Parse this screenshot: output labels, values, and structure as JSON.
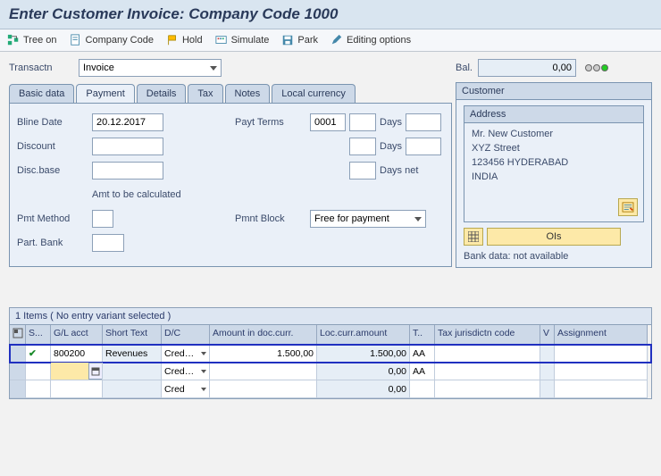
{
  "title": "Enter Customer Invoice: Company Code 1000",
  "toolbar": {
    "tree_on": "Tree on",
    "company_code": "Company Code",
    "hold": "Hold",
    "simulate": "Simulate",
    "park": "Park",
    "editing_options": "Editing options"
  },
  "transactn_label": "Transactn",
  "transactn_value": "Invoice",
  "balance": {
    "label": "Bal.",
    "value": "0,00"
  },
  "tabs": {
    "basic_data": "Basic data",
    "payment": "Payment",
    "details": "Details",
    "tax": "Tax",
    "notes": "Notes",
    "local_currency": "Local currency"
  },
  "payment": {
    "bline_date_label": "Bline Date",
    "bline_date_value": "20.12.2017",
    "discount_label": "Discount",
    "disc_base_label": "Disc.base",
    "amt_calc_label": "Amt to be calculated",
    "pmt_method_label": "Pmt Method",
    "part_bank_label": "Part. Bank",
    "payt_terms_label": "Payt Terms",
    "payt_terms_value": "0001",
    "days_label": "Days",
    "days_net_label": "Days net",
    "pmnt_block_label": "Pmnt Block",
    "pmnt_block_value": "Free for payment"
  },
  "customer": {
    "panel_title": "Customer",
    "address_title": "Address",
    "lines": [
      "Mr. New Customer",
      "XYZ Street",
      "123456 HYDERABAD",
      "INDIA"
    ],
    "ois_label": "OIs",
    "bank_data": "Bank data: not available"
  },
  "grid": {
    "caption": "1 Items ( No entry variant selected )",
    "headers": {
      "sel": "",
      "status": "S...",
      "gl": "G/L acct",
      "short": "Short Text",
      "dc": "D/C",
      "amt_doc": "Amount in doc.curr.",
      "amt_loc": "Loc.curr.amount",
      "t": "T..",
      "tax": "Tax jurisdictn code",
      "v": "V",
      "assign": "Assignment"
    },
    "rows": [
      {
        "status": "✔",
        "gl": "800200",
        "short": "Revenues",
        "dc": "Cred…",
        "amt_doc": "1.500,00",
        "amt_loc": "1.500,00",
        "t": "AA",
        "tax": "",
        "v": "",
        "assign": "",
        "selected": true
      },
      {
        "status": "",
        "gl": "",
        "short": "",
        "dc": "Cred…",
        "amt_doc": "",
        "amt_loc": "0,00",
        "t": "AA",
        "tax": "",
        "v": "",
        "assign": "",
        "active": true
      },
      {
        "status": "",
        "gl": "",
        "short": "",
        "dc": "Cred",
        "amt_doc": "",
        "amt_loc": "0,00",
        "t": "",
        "tax": "",
        "v": "",
        "assign": ""
      }
    ]
  }
}
